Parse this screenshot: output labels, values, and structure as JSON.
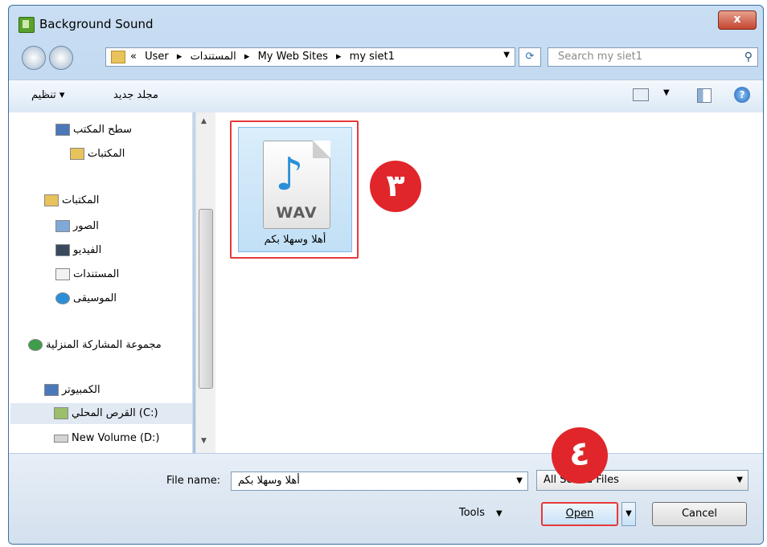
{
  "window": {
    "title": "Background Sound",
    "close_glyph": "x"
  },
  "address": {
    "crumbs": [
      "«",
      "User",
      "▸",
      "المستندات",
      "▸",
      "My Web Sites",
      "▸",
      "my siet1"
    ],
    "search_placeholder": "Search my siet1"
  },
  "toolbar": {
    "organize": "تنظيم ▾",
    "new_folder": "مجلد جديد"
  },
  "nav": {
    "items": [
      {
        "label": "سطح المكتب"
      },
      {
        "label": "المكتبات"
      },
      {
        "label": "المكتبات"
      },
      {
        "label": "الصور"
      },
      {
        "label": "الفيديو"
      },
      {
        "label": "المستندات"
      },
      {
        "label": "الموسيقى"
      },
      {
        "label": "مجموعة المشاركة المنزلية"
      },
      {
        "label": "الكمبيوتر"
      },
      {
        "label": "القرص المحلي (C:)"
      },
      {
        "label": "New Volume (D:)"
      }
    ]
  },
  "file": {
    "type_label": "WAV",
    "name": "أهلا وسهلا بكم"
  },
  "badges": {
    "step3": "٣",
    "step4": "٤"
  },
  "bottom": {
    "file_name_label": "File name:",
    "file_name_value": "أهلا وسهلا بكم",
    "file_type": "All Sound Files",
    "tools": "Tools",
    "open": "Open",
    "cancel": "Cancel"
  }
}
